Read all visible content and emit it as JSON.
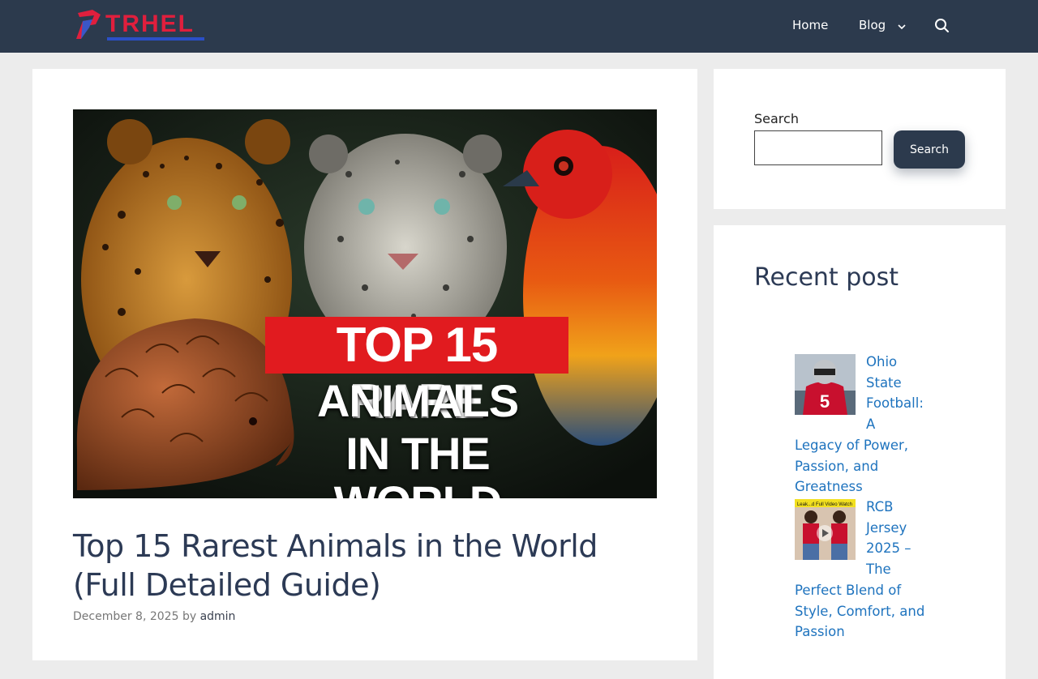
{
  "header": {
    "logo_text": "TRHEL",
    "nav": {
      "home": "Home",
      "blog": "Blog"
    },
    "icons": [
      "search-icon",
      "chevron-down-icon"
    ]
  },
  "hero": {
    "line1": "TOP 15 RARE",
    "line2": "ANIMALS",
    "line3": "IN THE WORLD"
  },
  "post": {
    "title": "Top 15 Rarest Animals in the World (Full Detailed Guide)",
    "date": "December 8, 2025",
    "by": "by",
    "author": "admin"
  },
  "sidebar": {
    "search_label": "Search",
    "search_value": "",
    "search_button": "Search",
    "recent_title": "Recent post",
    "recent_posts": [
      {
        "title": "Ohio State Football: A Legacy of Power, Passion, and Greatness"
      },
      {
        "title": "RCB Jersey 2025 – The Perfect Blend of Style, Comfort, and Passion",
        "thumb_text": "Leak...d Full Video Watch"
      }
    ]
  },
  "colors": {
    "header_bg": "#2c3a4d",
    "page_bg": "#ececec",
    "link": "#1e73be",
    "title": "#2c3a55",
    "hero_red": "#e11b1f"
  }
}
